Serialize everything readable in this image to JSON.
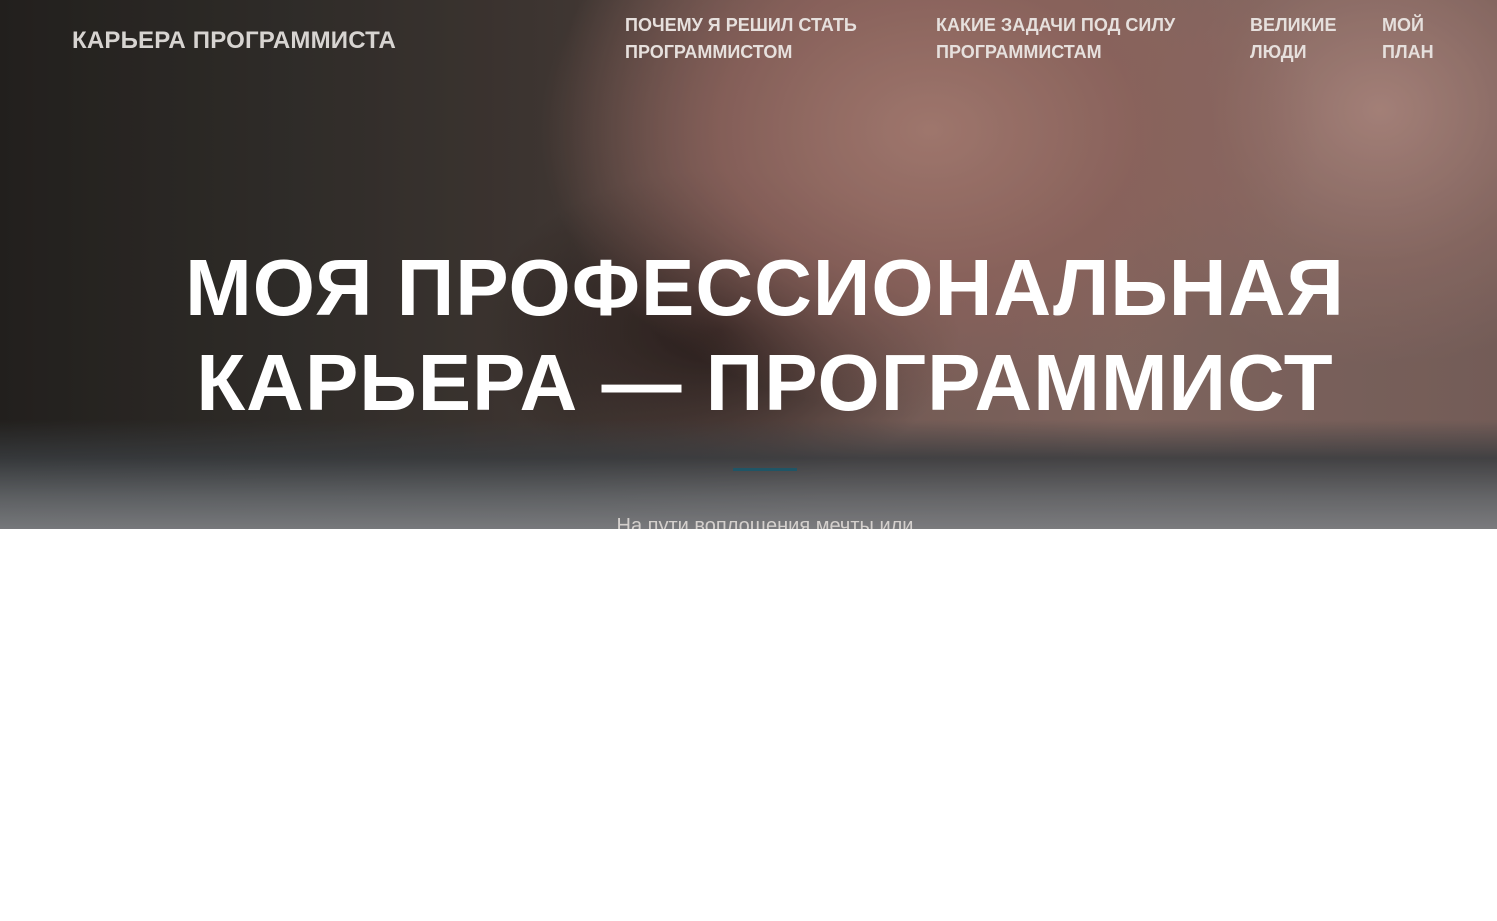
{
  "brand": {
    "title": "КАРЬЕРА ПРОГРАММИСТА"
  },
  "nav": {
    "items": [
      {
        "label": "ПОЧЕМУ Я РЕШИЛ СТАТЬ ПРОГРАММИСТОМ"
      },
      {
        "label": "КАКИЕ ЗАДАЧИ ПОД СИЛУ ПРОГРАММИСТАМ"
      },
      {
        "label": "ВЕЛИКИЕ ЛЮДИ"
      },
      {
        "label": "МОЙ ПЛАН"
      }
    ]
  },
  "hero": {
    "title": "МОЯ ПРОФЕССИОНАЛЬНАЯ КАРЬЕРА — ПРОГРАММИСТ",
    "subtitle": "На пути воплощения мечты или",
    "accent_color": "#1f5566"
  }
}
